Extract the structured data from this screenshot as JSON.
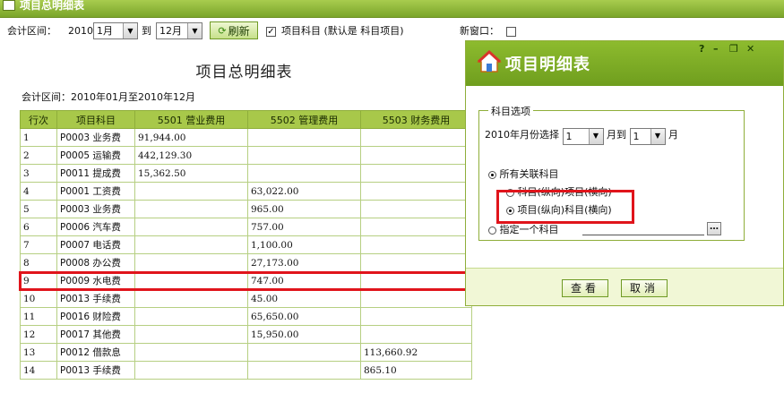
{
  "window": {
    "title": "项目总明细表"
  },
  "toolbar": {
    "period_label": "会计区间：",
    "year": "2010",
    "from_month": "1月",
    "to_label": "到",
    "to_month": "12月",
    "refresh_label": "刷新",
    "subject_check_label": "项目科目 (默认是 科目项目)",
    "new_window_label": "新窗口：",
    "check_mark": "✓"
  },
  "report": {
    "title": "项目总明细表",
    "period": "会计区间：2010年01月至2010年12月",
    "columns": [
      "行次",
      "项目科目",
      "5501 营业费用",
      "5502 管理费用",
      "5503 财务费用"
    ],
    "rows": [
      {
        "no": "1",
        "name": "P0003 业务费",
        "c5501": "91,944.00",
        "c5502": "",
        "c5503": ""
      },
      {
        "no": "2",
        "name": "P0005 运输费",
        "c5501": "442,129.30",
        "c5502": "",
        "c5503": ""
      },
      {
        "no": "3",
        "name": "P0011 提成费",
        "c5501": "15,362.50",
        "c5502": "",
        "c5503": ""
      },
      {
        "no": "4",
        "name": "P0001 工资费",
        "c5501": "",
        "c5502": "63,022.00",
        "c5503": ""
      },
      {
        "no": "5",
        "name": "P0003 业务费",
        "c5501": "",
        "c5502": "965.00",
        "c5503": ""
      },
      {
        "no": "6",
        "name": "P0006 汽车费",
        "c5501": "",
        "c5502": "757.00",
        "c5503": ""
      },
      {
        "no": "7",
        "name": "P0007 电话费",
        "c5501": "",
        "c5502": "1,100.00",
        "c5503": ""
      },
      {
        "no": "8",
        "name": "P0008 办公费",
        "c5501": "",
        "c5502": "27,173.00",
        "c5503": ""
      },
      {
        "no": "9",
        "name": "P0009 水电费",
        "c5501": "",
        "c5502": "747.00",
        "c5503": ""
      },
      {
        "no": "10",
        "name": "P0013 手续费",
        "c5501": "",
        "c5502": "45.00",
        "c5503": ""
      },
      {
        "no": "11",
        "name": "P0016 财险费",
        "c5501": "",
        "c5502": "65,650.00",
        "c5503": ""
      },
      {
        "no": "12",
        "name": "P0017 其他费",
        "c5501": "",
        "c5502": "15,950.00",
        "c5503": ""
      },
      {
        "no": "13",
        "name": "P0012 借款息",
        "c5501": "",
        "c5502": "",
        "c5503": "113,660.92"
      },
      {
        "no": "14",
        "name": "P0013 手续费",
        "c5501": "",
        "c5502": "",
        "c5503": "865.10"
      }
    ]
  },
  "dialog": {
    "title": "项目明细表",
    "controls": {
      "help": "?",
      "minimize": "–",
      "restore": "❐",
      "close": "✕"
    },
    "group_label": "科目选项",
    "month_prefix": "2010年月份选择",
    "month_from": "1",
    "month_mid": "月到",
    "month_to": "1",
    "month_suffix": "月",
    "all_subjects_label": "所有关联科目",
    "option_subject_project": "科目(纵向)项目(横向)",
    "option_project_subject": "项目(纵向)科目(横向)",
    "specify_subject_label": "指定一个科目",
    "dots": "…",
    "view_button": "查看",
    "cancel_button": "取消"
  },
  "colors": {
    "accent": "#7aa52a",
    "header": "#a8c84a",
    "highlight": "#e0141b"
  }
}
